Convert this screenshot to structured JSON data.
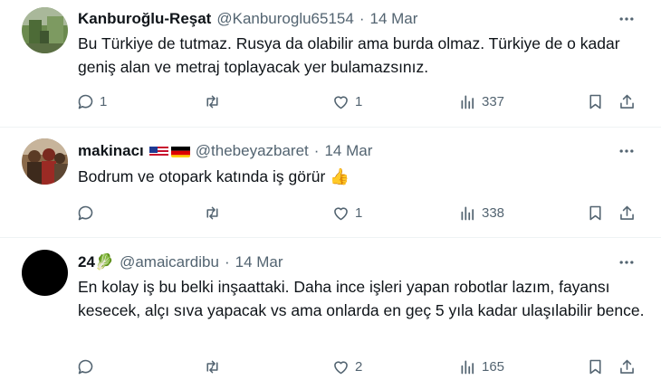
{
  "tweets": [
    {
      "name": "Kanburoğlu-Reşat",
      "handle": "@Kanburoglu65154",
      "separator": "·",
      "time": "14 Mar",
      "text": "Bu Türkiye de tutmaz. Rusya da olabilir ama burda olmaz. Türkiye de o kadar geniş alan ve metraj toplayacak yer bulamazsınız.",
      "reply_count": "1",
      "retweet_count": "",
      "like_count": "1",
      "view_count": "337",
      "avatar_icon": "photo-avatar-green"
    },
    {
      "name": "makinacı",
      "flags": [
        "us-flag",
        "germany-flag"
      ],
      "handle": "@thebeyazbaret",
      "separator": "·",
      "time": "14 Mar",
      "text": "Bodrum ve otopark katında iş görür 👍",
      "reply_count": "",
      "retweet_count": "",
      "like_count": "1",
      "view_count": "338",
      "avatar_icon": "photo-avatar-group"
    },
    {
      "name": "24🥬",
      "handle": "@amaicardibu",
      "separator": "·",
      "time": "14 Mar",
      "text": "En kolay iş bu belki inşaattaki. Daha ince işleri yapan robotlar lazım, fayansı kesecek, alçı sıva yapacak vs ama onlarda en geç 5 yıla kadar ulaşılabilir bence.",
      "reply_count": "",
      "retweet_count": "",
      "like_count": "2",
      "view_count": "165",
      "avatar_icon": "black-avatar"
    }
  ],
  "colors": {
    "text": "#0f1419",
    "muted": "#536471",
    "divider": "#eff3f4"
  }
}
